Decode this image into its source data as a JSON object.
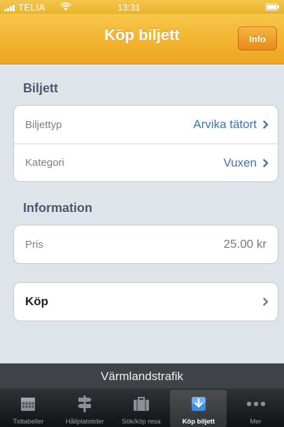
{
  "status_bar": {
    "carrier": "TELIA",
    "time": "13:31"
  },
  "nav": {
    "title": "Köp biljett",
    "info_label": "Info"
  },
  "sections": {
    "ticket_header": "Biljett",
    "ticket_rows": [
      {
        "label": "Biljettyp",
        "value": "Arvika tätort"
      },
      {
        "label": "Kategori",
        "value": "Vuxen"
      }
    ],
    "info_header": "Information",
    "price_row": {
      "label": "Pris",
      "value": "25.00 kr"
    },
    "buy_label": "Köp"
  },
  "brand": "Värmlandstrafik",
  "tabs": [
    {
      "label": "Tidtabeller",
      "icon": "calendar-icon",
      "selected": false
    },
    {
      "label": "Hållplatstider",
      "icon": "signpost-icon",
      "selected": false
    },
    {
      "label": "Sök/köp resa",
      "icon": "briefcase-icon",
      "selected": false
    },
    {
      "label": "Köp biljett",
      "icon": "download-icon",
      "selected": true
    },
    {
      "label": "Mer",
      "icon": "more-icon",
      "selected": false
    }
  ],
  "colors": {
    "nav_accent": "#f2b430",
    "value_blue": "#3e71b8",
    "info_button": "#e88a1c"
  }
}
